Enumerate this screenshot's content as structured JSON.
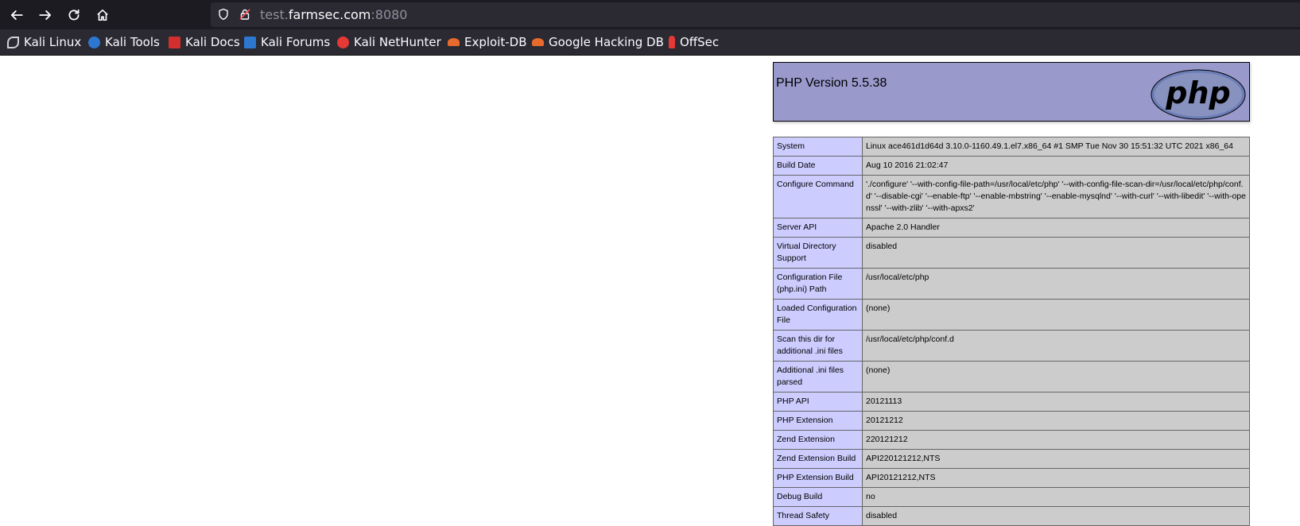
{
  "browser": {
    "url_host_prefix": "test.",
    "url_host_domain": "farmsec.com",
    "url_port": ":8080"
  },
  "bookmarks": [
    {
      "label": "Kali Linux",
      "color": "#d0d0d0",
      "icon": "kali-dragon-icon"
    },
    {
      "label": "Kali Tools",
      "color": "#2e77d0",
      "icon": "kali-tools-icon"
    },
    {
      "label": "Kali Docs",
      "color": "#d32f2f",
      "icon": "kali-docs-icon"
    },
    {
      "label": "Kali Forums",
      "color": "#2e77d0",
      "icon": "kali-forums-icon"
    },
    {
      "label": "Kali NetHunter",
      "color": "#e53935",
      "icon": "kali-nethunter-icon"
    },
    {
      "label": "Exploit-DB",
      "color": "#e86a2c",
      "icon": "exploit-db-icon"
    },
    {
      "label": "Google Hacking DB",
      "color": "#e86a2c",
      "icon": "ghdb-icon"
    },
    {
      "label": "OffSec",
      "color": "#e53935",
      "icon": "offsec-icon"
    }
  ],
  "phpinfo": {
    "title": "PHP Version 5.5.38",
    "logo_text": "php",
    "rows": [
      {
        "key": "System",
        "value": "Linux ace461d1d64d 3.10.0-1160.49.1.el7.x86_64 #1 SMP Tue Nov 30 15:51:32 UTC 2021 x86_64"
      },
      {
        "key": "Build Date",
        "value": "Aug 10 2016 21:02:47"
      },
      {
        "key": "Configure Command",
        "value": "'./configure' '--with-config-file-path=/usr/local/etc/php' '--with-config-file-scan-dir=/usr/local/etc/php/conf.d' '--disable-cgi' '--enable-ftp' '--enable-mbstring' '--enable-mysqlnd' '--with-curl' '--with-libedit' '--with-openssl' '--with-zlib' '--with-apxs2'"
      },
      {
        "key": "Server API",
        "value": "Apache 2.0 Handler"
      },
      {
        "key": "Virtual Directory Support",
        "value": "disabled"
      },
      {
        "key": "Configuration File (php.ini) Path",
        "value": "/usr/local/etc/php"
      },
      {
        "key": "Loaded Configuration File",
        "value": "(none)"
      },
      {
        "key": "Scan this dir for additional .ini files",
        "value": "/usr/local/etc/php/conf.d"
      },
      {
        "key": "Additional .ini files parsed",
        "value": "(none)"
      },
      {
        "key": "PHP API",
        "value": "20121113"
      },
      {
        "key": "PHP Extension",
        "value": "20121212"
      },
      {
        "key": "Zend Extension",
        "value": "220121212"
      },
      {
        "key": "Zend Extension Build",
        "value": "API220121212,NTS"
      },
      {
        "key": "PHP Extension Build",
        "value": "API20121212,NTS"
      },
      {
        "key": "Debug Build",
        "value": "no"
      },
      {
        "key": "Thread Safety",
        "value": "disabled"
      }
    ]
  }
}
